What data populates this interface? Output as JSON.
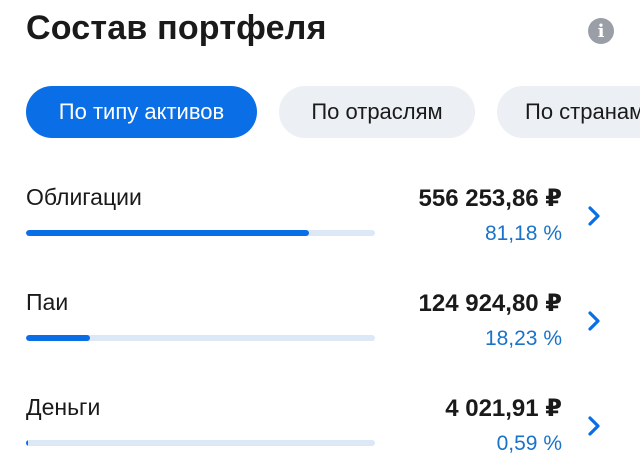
{
  "header": {
    "title": "Состав портфеля",
    "info_icon": "info-icon"
  },
  "tabs": [
    {
      "label": "По типу активов",
      "active": true
    },
    {
      "label": "По отраслям",
      "active": false
    },
    {
      "label": "По странам",
      "active": false
    }
  ],
  "assets": [
    {
      "label": "Облигации",
      "amount": "556 253,86 ₽",
      "percent": "81,18 %",
      "share": 0.8118
    },
    {
      "label": "Паи",
      "amount": "124 924,80 ₽",
      "percent": "18,23 %",
      "share": 0.1823
    },
    {
      "label": "Деньги",
      "amount": "4 021,91 ₽",
      "percent": "0,59 %",
      "share": 0.0059
    }
  ],
  "colors": {
    "accent": "#0a6ee6",
    "percent_text": "#1a73c9",
    "bar_track": "#dde8f6",
    "tab_inactive": "#eceff3"
  }
}
